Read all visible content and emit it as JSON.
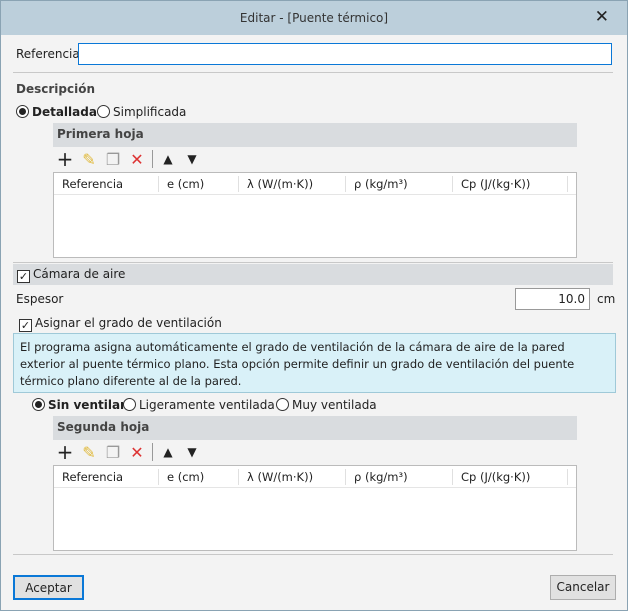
{
  "window": {
    "title": "Editar - [Puente térmico]"
  },
  "referencia": {
    "label": "Referencia",
    "value": ""
  },
  "descripcion": {
    "label": "Descripción",
    "options": [
      "Detallada",
      "Simplificada"
    ],
    "selected": "Detallada"
  },
  "primera_hoja": {
    "title": "Primera hoja",
    "columns": [
      "Referencia",
      "e (cm)",
      "λ (W/(m·K))",
      "ρ (kg/m³)",
      "Cp (J/(kg·K))"
    ],
    "rows": []
  },
  "camara": {
    "label": "Cámara de aire",
    "checked": true,
    "espesor_label": "Espesor",
    "espesor_value": "10.0",
    "unit": "cm",
    "asignar_label": "Asignar el grado de ventilación",
    "asignar_checked": true,
    "info": "El programa asigna automáticamente el grado de ventilación de la cámara de aire de la pared exterior al puente térmico plano. Esta opción permite definir un grado de ventilación del puente térmico plano diferente al de la pared.",
    "ventilacion": [
      "Sin ventilar",
      "Ligeramente ventilada",
      "Muy ventilada"
    ],
    "selected": "Sin ventilar"
  },
  "segunda_hoja": {
    "title": "Segunda hoja",
    "columns": [
      "Referencia",
      "e (cm)",
      "λ (W/(m·K))",
      "ρ (kg/m³)",
      "Cp (J/(kg·K))"
    ],
    "rows": []
  },
  "footer": {
    "accept": "Aceptar",
    "cancel": "Cancelar"
  }
}
